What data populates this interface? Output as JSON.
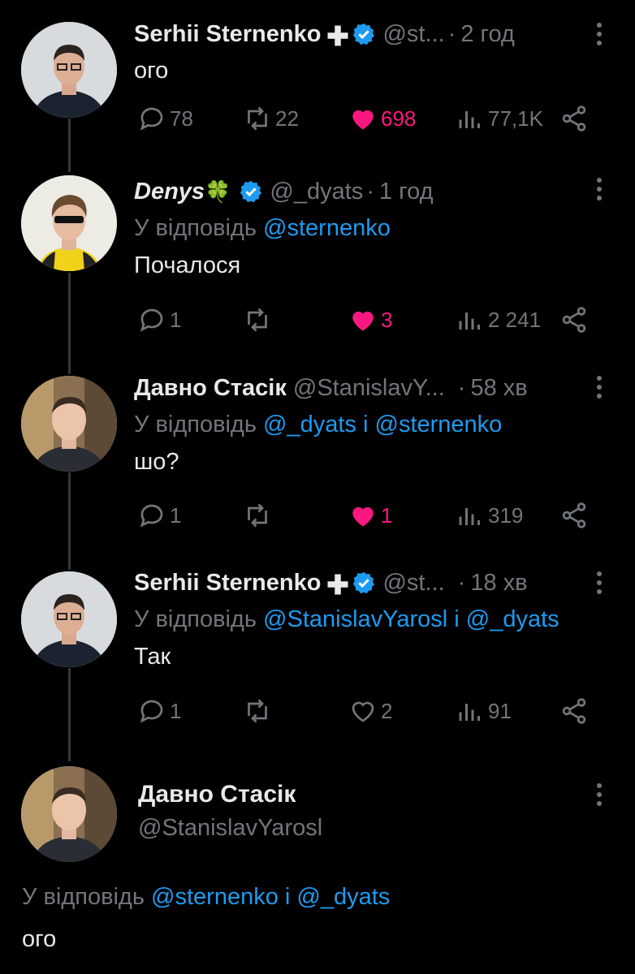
{
  "tweets": [
    {
      "name": "Serhii Sternenko",
      "name_emoji": "➕",
      "handle": "@st...",
      "time": "2 год",
      "reply_prefix": "",
      "reply_mentions": [],
      "text": "ого",
      "replies": "78",
      "retweets": "22",
      "likes": "698",
      "liked": true,
      "views": "77,1K"
    },
    {
      "name": "Denys",
      "name_emoji": "🍀",
      "handle": "@_dyats",
      "time": "1 год",
      "reply_prefix": "У відповідь",
      "reply_mentions": [
        "@sternenko"
      ],
      "text": "Почалося",
      "replies": "1",
      "retweets": "",
      "likes": "3",
      "liked": true,
      "views": "2 241"
    },
    {
      "name": "Давно Стасік",
      "name_emoji": "",
      "handle": "@StanislavY...",
      "time": "58 хв",
      "reply_prefix": "У відповідь",
      "reply_mentions": [
        "@_dyats",
        "@sternenko"
      ],
      "text": "шо?",
      "replies": "1",
      "retweets": "",
      "likes": "1",
      "liked": true,
      "views": "319"
    },
    {
      "name": "Serhii Sternenko",
      "name_emoji": "➕",
      "handle": "@st...",
      "time": "18 хв",
      "reply_prefix": "У відповідь",
      "reply_mentions": [
        "@StanislavYarosl",
        "@_dyats"
      ],
      "text": "Так",
      "replies": "1",
      "retweets": "",
      "likes": "2",
      "liked": false,
      "views": "91"
    }
  ],
  "conjunction": "і",
  "focused": {
    "name": "Давно Стасік",
    "handle": "@StanislavYarosl",
    "reply_prefix": "У відповідь",
    "reply_mentions": [
      "@sternenko",
      "@_dyats"
    ],
    "text": "ого"
  },
  "colors": {
    "background": "#000000",
    "text": "#e7e9ea",
    "muted": "#71767b",
    "link": "#1d9bf0",
    "like": "#f91880",
    "verified": "#1d9bf0"
  }
}
